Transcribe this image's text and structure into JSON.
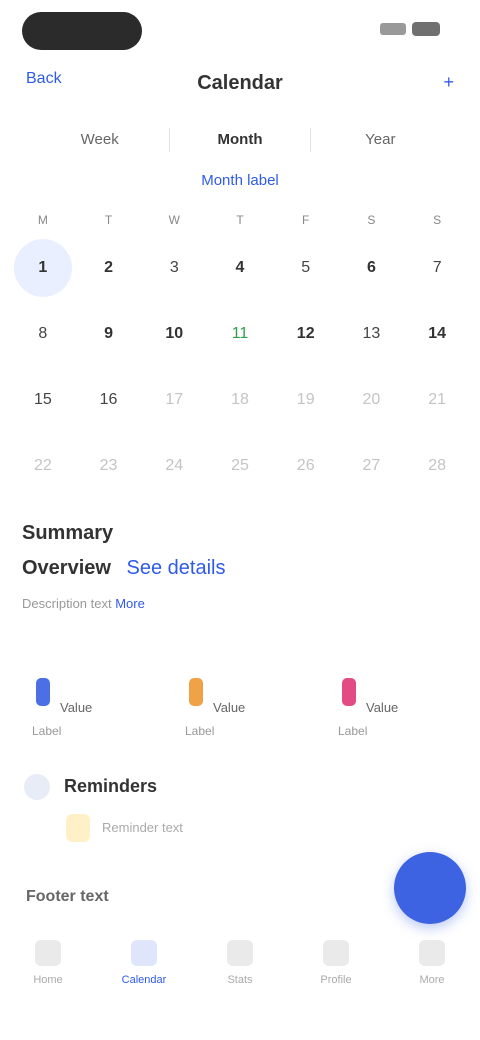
{
  "nav": {
    "back": "Back",
    "title": "Calendar",
    "action": "+"
  },
  "segments": [
    "Week",
    "Month",
    "Year"
  ],
  "month_label": "Month label",
  "calendar": {
    "weekdays": [
      "M",
      "T",
      "W",
      "T",
      "F",
      "S",
      "S"
    ],
    "rows": [
      [
        "1",
        "2",
        "3",
        "4",
        "5",
        "6",
        "7"
      ],
      [
        "8",
        "9",
        "10",
        "11",
        "12",
        "13",
        "14"
      ],
      [
        "15",
        "16",
        "17",
        "18",
        "19",
        "20",
        "21"
      ],
      [
        "22",
        "23",
        "24",
        "25",
        "26",
        "27",
        "28"
      ]
    ]
  },
  "summary": {
    "title": "Summary",
    "subtitle": "Overview",
    "link": "See details",
    "description": "Description text",
    "more": "More"
  },
  "stats": [
    {
      "label": "Label",
      "value": "Value",
      "color": "#4d6fe5"
    },
    {
      "label": "Label",
      "value": "Value",
      "color": "#f0a346"
    },
    {
      "label": "Label",
      "value": "Value",
      "color": "#e24b83"
    }
  ],
  "reminder": {
    "title": "Reminders",
    "text": "Reminder text"
  },
  "footer_text": "Footer text",
  "tabs": [
    "Home",
    "Calendar",
    "Stats",
    "Profile",
    "More"
  ]
}
